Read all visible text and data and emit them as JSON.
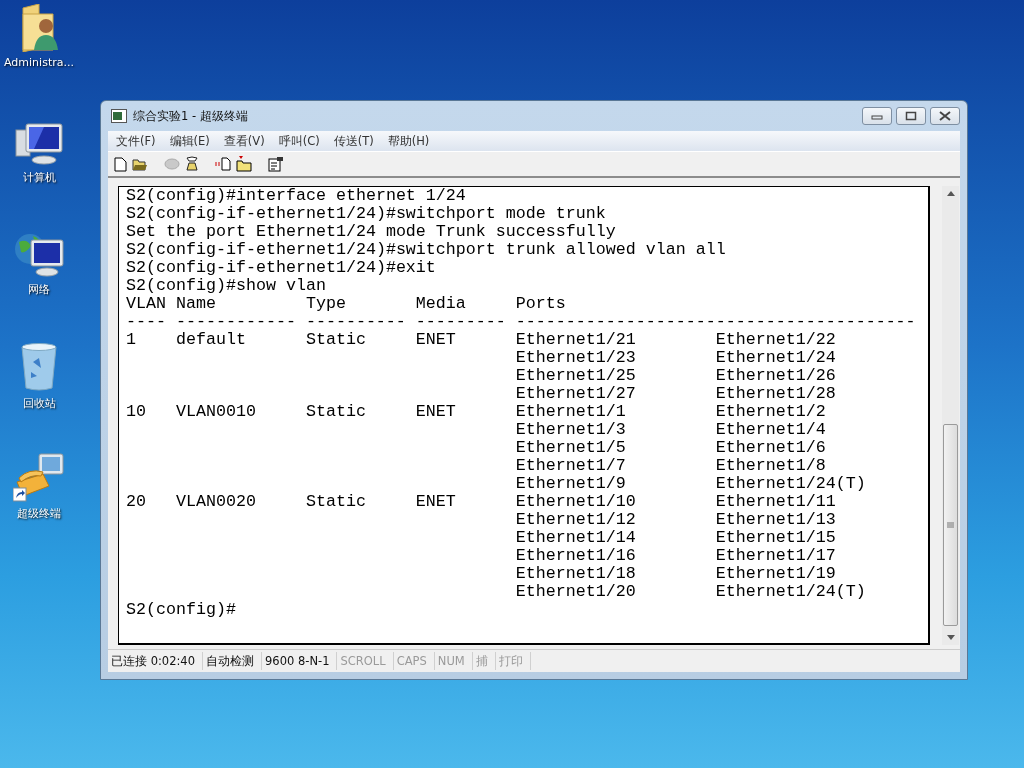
{
  "desktop_icons": [
    {
      "kind": "user-folder",
      "label": "Administra..."
    },
    {
      "kind": "computer",
      "label": "计算机"
    },
    {
      "kind": "network",
      "label": "网络"
    },
    {
      "kind": "recycle-bin",
      "label": "回收站"
    },
    {
      "kind": "terminal-shortcut",
      "label": "超级终端"
    }
  ],
  "window": {
    "title": "综合实验1 - 超级终端",
    "menu": [
      "文件(F)",
      "编辑(E)",
      "查看(V)",
      "呼叫(C)",
      "传送(T)",
      "帮助(H)"
    ],
    "terminal": {
      "lines_before": [
        "S2(config)#interface ethernet 1/24",
        "S2(config-if-ethernet1/24)#switchport mode trunk",
        "Set the port Ethernet1/24 mode Trunk successfully",
        "S2(config-if-ethernet1/24)#switchport trunk allowed vlan all",
        "S2(config-if-ethernet1/24)#exit",
        "S2(config)#show vlan"
      ],
      "columns": [
        "VLAN",
        "Name",
        "Type",
        "Media",
        "Ports"
      ],
      "rules": [
        "----",
        "------------",
        "----------",
        "---------",
        "----------------------------------------"
      ],
      "vlans": [
        {
          "vlan": "1",
          "name": "default",
          "type": "Static",
          "media": "ENET",
          "ports": [
            "Ethernet1/21",
            "Ethernet1/22",
            "Ethernet1/23",
            "Ethernet1/24",
            "Ethernet1/25",
            "Ethernet1/26",
            "Ethernet1/27",
            "Ethernet1/28"
          ]
        },
        {
          "vlan": "10",
          "name": "VLAN0010",
          "type": "Static",
          "media": "ENET",
          "ports": [
            "Ethernet1/1",
            "Ethernet1/2",
            "Ethernet1/3",
            "Ethernet1/4",
            "Ethernet1/5",
            "Ethernet1/6",
            "Ethernet1/7",
            "Ethernet1/8",
            "Ethernet1/9",
            "Ethernet1/24(T)"
          ]
        },
        {
          "vlan": "20",
          "name": "VLAN0020",
          "type": "Static",
          "media": "ENET",
          "ports": [
            "Ethernet1/10",
            "Ethernet1/11",
            "Ethernet1/12",
            "Ethernet1/13",
            "Ethernet1/14",
            "Ethernet1/15",
            "Ethernet1/16",
            "Ethernet1/17",
            "Ethernet1/18",
            "Ethernet1/19",
            "Ethernet1/20",
            "Ethernet1/24(T)"
          ]
        }
      ],
      "prompt": "S2(config)#"
    },
    "status_bar": [
      {
        "text": "已连接 0:02:40",
        "disabled": false
      },
      {
        "text": "自动检测",
        "disabled": false
      },
      {
        "text": "9600 8-N-1",
        "disabled": false
      },
      {
        "text": "SCROLL",
        "disabled": true
      },
      {
        "text": "CAPS",
        "disabled": true
      },
      {
        "text": "NUM",
        "disabled": true
      },
      {
        "text": "捕",
        "disabled": true
      },
      {
        "text": "打印",
        "disabled": true
      }
    ]
  }
}
